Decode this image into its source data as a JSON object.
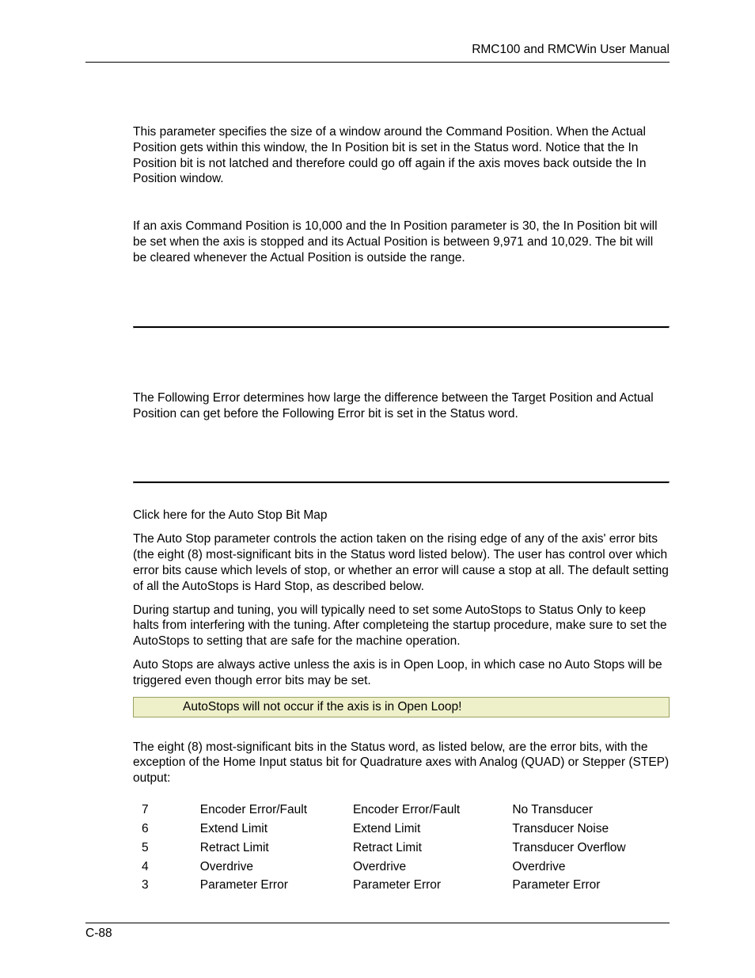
{
  "header": {
    "title": "RMC100 and RMCWin User Manual"
  },
  "section1": {
    "p1": "This parameter specifies the size of a window around the Command Position. When the Actual Position gets within this window, the In Position bit is set in the Status word. Notice that the In Position bit is not latched and therefore could go off again if the axis moves back outside the In Position window.",
    "p2": "If an axis Command Position is 10,000 and the In Position parameter is 30, the In Position bit will be set when the axis is stopped and its Actual Position is between 9,971 and 10,029. The bit will be cleared whenever the Actual Position is outside the range."
  },
  "section2": {
    "p1": "The Following Error determines how large the difference between the Target Position and Actual Position can get before the Following Error bit is set in the Status word."
  },
  "section3": {
    "link": "Click here for the Auto Stop Bit Map",
    "p1": "The Auto Stop parameter controls the action taken on the rising edge of any of the axis' error bits (the eight (8) most-significant bits in the Status word listed below). The user has control over which error bits cause which levels of stop, or whether an error will cause a stop at all. The default setting of all the AutoStops is Hard Stop, as described below.",
    "p2": "During startup and tuning, you will typically need to set some AutoStops to Status Only to keep halts from interfering with the tuning. After completeing the startup procedure, make sure to set the AutoStops to setting that are safe for the machine operation.",
    "p3": "Auto Stops are always active unless the axis is in Open Loop, in which case no Auto Stops will be triggered even though error bits may be set.",
    "note": "AutoStops will not occur if the axis is in Open Loop!",
    "p4": "The eight (8) most-significant bits in the Status word, as listed below, are the error bits, with the exception of the Home Input status bit for Quadrature axes with Analog (QUAD) or Stepper (STEP) output:"
  },
  "table": {
    "rows": [
      {
        "bit": "7",
        "c1": "Encoder Error/Fault",
        "c2": "Encoder Error/Fault",
        "c3": "No Transducer"
      },
      {
        "bit": "6",
        "c1": "Extend Limit",
        "c2": "Extend Limit",
        "c3": "Transducer Noise"
      },
      {
        "bit": "5",
        "c1": "Retract Limit",
        "c2": "Retract Limit",
        "c3": "Transducer Overflow"
      },
      {
        "bit": "4",
        "c1": "Overdrive",
        "c2": "Overdrive",
        "c3": "Overdrive"
      },
      {
        "bit": "3",
        "c1": "Parameter Error",
        "c2": "Parameter Error",
        "c3": "Parameter Error"
      }
    ]
  },
  "footer": {
    "page": "C-88"
  }
}
